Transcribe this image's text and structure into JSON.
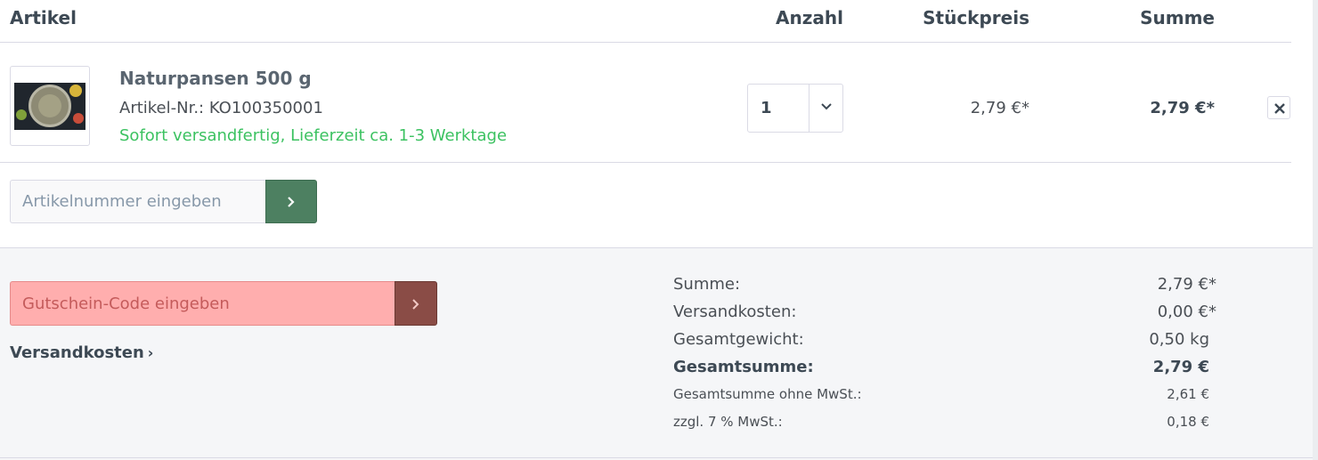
{
  "header": {
    "artikel": "Artikel",
    "anzahl": "Anzahl",
    "stueckpreis": "Stückpreis",
    "summe": "Summe"
  },
  "item": {
    "name": "Naturpansen 500 g",
    "article_number": "Artikel-Nr.: KO100350001",
    "delivery": "Sofort versandfertig, Lieferzeit ca. 1-3 Werktage",
    "quantity": "1",
    "unit_price": "2,79 €*",
    "total": "2,79 €*"
  },
  "article_input": {
    "placeholder": "Artikelnummer eingeben"
  },
  "voucher": {
    "placeholder": "Gutschein-Code eingeben"
  },
  "shipping_link": {
    "label": "Versandkosten"
  },
  "summary": {
    "summe_label": "Summe:",
    "summe_value": "2,79 €*",
    "versand_label": "Versandkosten:",
    "versand_value": "0,00 €*",
    "gewicht_label": "Gesamtgewicht:",
    "gewicht_value": "0,50 kg",
    "gesamt_label": "Gesamtsumme:",
    "gesamt_value": "2,79 €",
    "netto_label": "Gesamtsumme ohne MwSt.:",
    "netto_value": "2,61 €",
    "mwst_label": "zzgl. 7 % MwSt.:",
    "mwst_value": "0,18 €"
  },
  "colors": {
    "accent_green": "#4d8061",
    "delivery_green": "#3cc261",
    "voucher_error_bg": "#ffaeae",
    "voucher_button": "#8a4c46"
  },
  "icons": {
    "quantity_dropdown": "chevron-down-icon",
    "remove": "close-icon",
    "article_submit": "chevron-right-icon",
    "voucher_submit": "chevron-right-icon",
    "shipping_link": "chevron-right-icon"
  }
}
